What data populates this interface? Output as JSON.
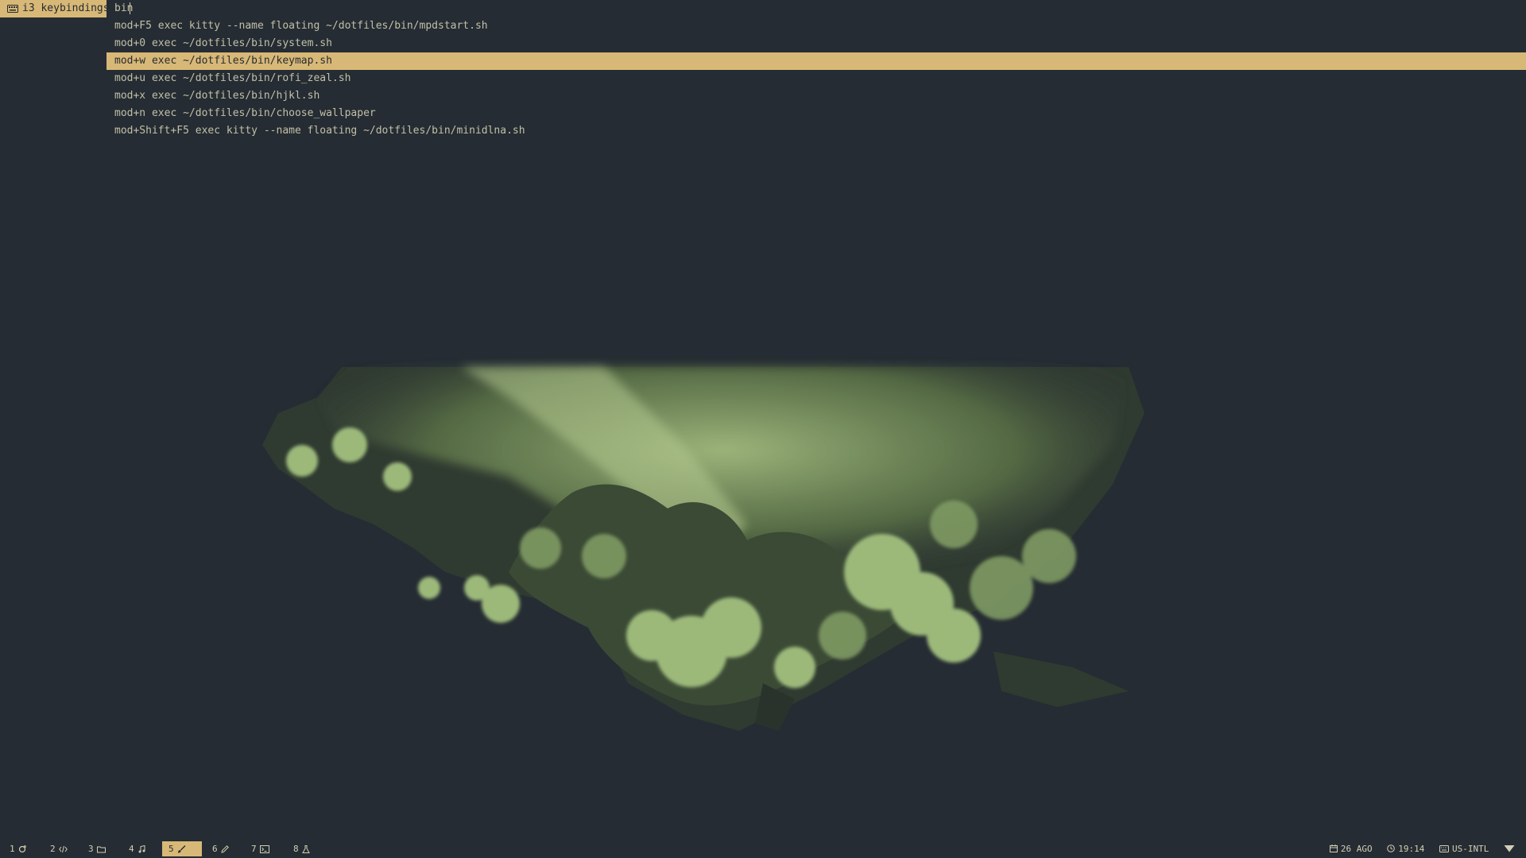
{
  "rofi": {
    "mode_label": "i3 keybindings",
    "query": "bin",
    "results": [
      "mod+F5 exec kitty --name floating ~/dotfiles/bin/mpdstart.sh",
      "mod+0 exec ~/dotfiles/bin/system.sh",
      "mod+w exec ~/dotfiles/bin/keymap.sh",
      "mod+u exec ~/dotfiles/bin/rofi_zeal.sh",
      "mod+x exec ~/dotfiles/bin/hjkl.sh",
      "mod+n exec ~/dotfiles/bin/choose_wallpaper",
      "mod+Shift+F5 exec kitty --name floating ~/dotfiles/bin/minidlna.sh"
    ],
    "selected_index": 2
  },
  "bar": {
    "workspaces": [
      {
        "num": "1",
        "icon": "refresh-icon"
      },
      {
        "num": "2",
        "icon": "code-icon"
      },
      {
        "num": "3",
        "icon": "folder-icon"
      },
      {
        "num": "4",
        "icon": "music-icon"
      },
      {
        "num": "5",
        "icon": "brush-icon"
      },
      {
        "num": "6",
        "icon": "pencil-icon"
      },
      {
        "num": "7",
        "icon": "terminal-icon"
      },
      {
        "num": "8",
        "icon": "flask-icon"
      }
    ],
    "focused_workspace": "5",
    "date": "26 AGO",
    "time": "19:14",
    "keyboard_layout": "US-INTL",
    "wifi_icon": "wifi-icon"
  },
  "colors": {
    "background": "#252c33",
    "accent": "#d8b877",
    "foreground": "#c2c0a8",
    "wallpaper_green": "#8fae6c"
  }
}
